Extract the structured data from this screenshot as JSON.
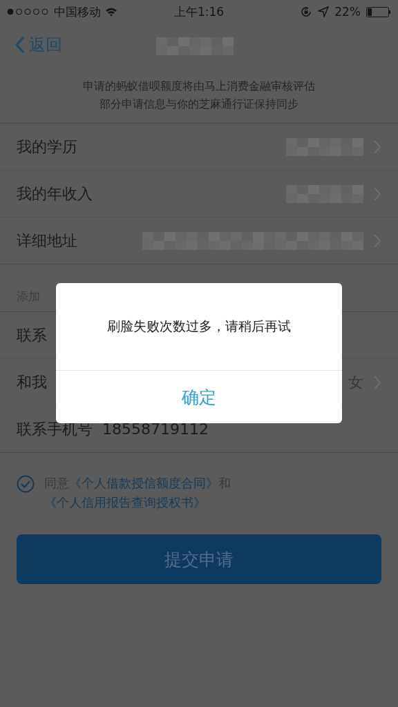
{
  "status_bar": {
    "carrier": "中国移动",
    "time": "上午1:16",
    "battery": "22%"
  },
  "nav": {
    "back": "返回"
  },
  "notice": [
    "申请的蚂蚁借呗额度将由马上消费金融审核评估",
    "部分申请信息与你的芝麻通行证保持同步"
  ],
  "rows": [
    {
      "label": "我的学历",
      "kind": "blurred"
    },
    {
      "label": "我的年收入",
      "kind": "blurred"
    },
    {
      "label": "详细地址",
      "kind": "blurred_wide"
    }
  ],
  "section": "添加",
  "contact_rows": [
    {
      "label": "联系",
      "kind": "plain"
    },
    {
      "label": "和我",
      "value": "女",
      "kind": "chevron"
    },
    {
      "label": "联系手机号",
      "value": "18558719112",
      "kind": "phone"
    }
  ],
  "agreement": {
    "checked": true,
    "prefix": "同意",
    "link_1": "《个人借款授信额度合同》",
    "middle": "和",
    "link_2": "《个人信用报告查询授权书》"
  },
  "submit": "提交申请",
  "dialog": {
    "message": "刷脸失败次数过多，请稍后再试",
    "button": "确定"
  }
}
